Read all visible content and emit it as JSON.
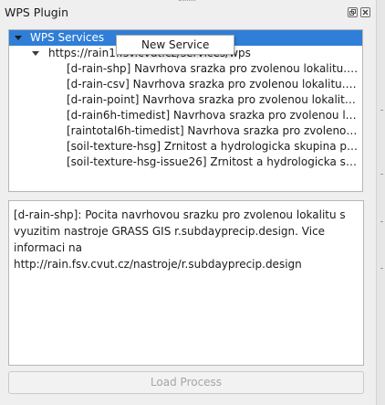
{
  "window": {
    "title": "WPS Plugin"
  },
  "tree": {
    "root": {
      "label": "WPS Services",
      "expanded": true,
      "selected": true
    },
    "server": {
      "label": "https://rain1.fsv.cvut.cz/services/wps",
      "expanded": true
    },
    "processes": [
      {
        "label": "[d-rain-shp] Navrhova srazka pro zvolenou lokalitu. Vra..."
      },
      {
        "label": "[d-rain-csv] Navrhova srazka pro zvolenou lokalitu. Vrac..."
      },
      {
        "label": "[d-rain-point] Navrhova srazka pro zvolenou lokalitu. Vr..."
      },
      {
        "label": "[d-rain6h-timedist] Navrhova srazka pro zvolenou lokali..."
      },
      {
        "label": "[raintotal6h-timedist] Navrhova srazka pro zvolenou lok..."
      },
      {
        "label": "[soil-texture-hsg] Zrnitost a hydrologicka skupina pudy"
      },
      {
        "label": "[soil-texture-hsg-issue26] Zrnitost a hydrologicka skupi..."
      }
    ]
  },
  "context_menu": {
    "items": [
      {
        "label": "New Service"
      }
    ]
  },
  "description": {
    "text": "[d-rain-shp]: Pocita navrhovou srazku pro zvolenou lokalitu s vyuzitim nastroje GRASS GIS r.subdayprecip.design. Vice informaci na http://rain.fsv.cvut.cz/nastroje/r.subdayprecip.design"
  },
  "buttons": {
    "load_process": "Load Process",
    "load_process_enabled": false
  },
  "colors": {
    "selection": "#2f7ed8",
    "background": "#efefef",
    "disabled_text": "#a6a6a6"
  },
  "icons": {
    "float": "float-icon",
    "close": "close-icon",
    "expand": "expand-arrow-icon"
  }
}
